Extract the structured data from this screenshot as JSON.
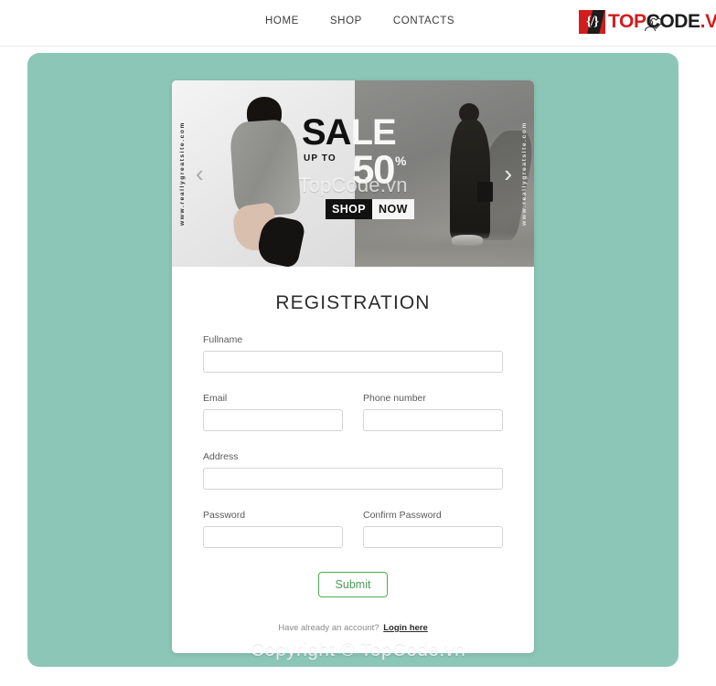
{
  "header": {
    "nav": [
      {
        "label": "HOME",
        "name": "nav-link-home"
      },
      {
        "label": "SHOP",
        "name": "nav-link-shop"
      },
      {
        "label": "CONTACTS",
        "name": "nav-link-contacts"
      }
    ],
    "icons": {
      "wishlist": "heart-icon",
      "account": "user-icon"
    }
  },
  "watermark_logo": {
    "mark": "{/}",
    "part1": "TOP",
    "part2": "CODE",
    "part3": ".VN"
  },
  "banner": {
    "sale_dark": "SA",
    "sale_light": "LE",
    "up_to": "UP TO",
    "discount": "50",
    "percent": "%",
    "shop": "SHOP",
    "now": "NOW",
    "url_left": "www.reallygreatsite.com",
    "url_right": "www.reallygreatsite.com",
    "prev_arrow": "‹",
    "next_arrow": "›",
    "watermark": "TopCode.vn"
  },
  "form": {
    "title": "REGISTRATION",
    "fields": {
      "fullname": {
        "label": "Fullname",
        "value": "",
        "placeholder": ""
      },
      "email": {
        "label": "Email",
        "value": "",
        "placeholder": ""
      },
      "phone": {
        "label": "Phone number",
        "value": "",
        "placeholder": ""
      },
      "address": {
        "label": "Address",
        "value": "",
        "placeholder": ""
      },
      "password": {
        "label": "Password",
        "value": "",
        "placeholder": ""
      },
      "confirm_password": {
        "label": "Confirm Password",
        "value": "",
        "placeholder": ""
      }
    },
    "submit_label": "Submit",
    "login_prompt": "Have already an account?",
    "login_link": "Login here"
  },
  "footer_watermark": "Copyright © TopCode.vn",
  "colors": {
    "panel_teal": "#8cc6b7",
    "submit_green": "#4caf50",
    "logo_red": "#d21d1d",
    "card_white": "#ffffff"
  }
}
